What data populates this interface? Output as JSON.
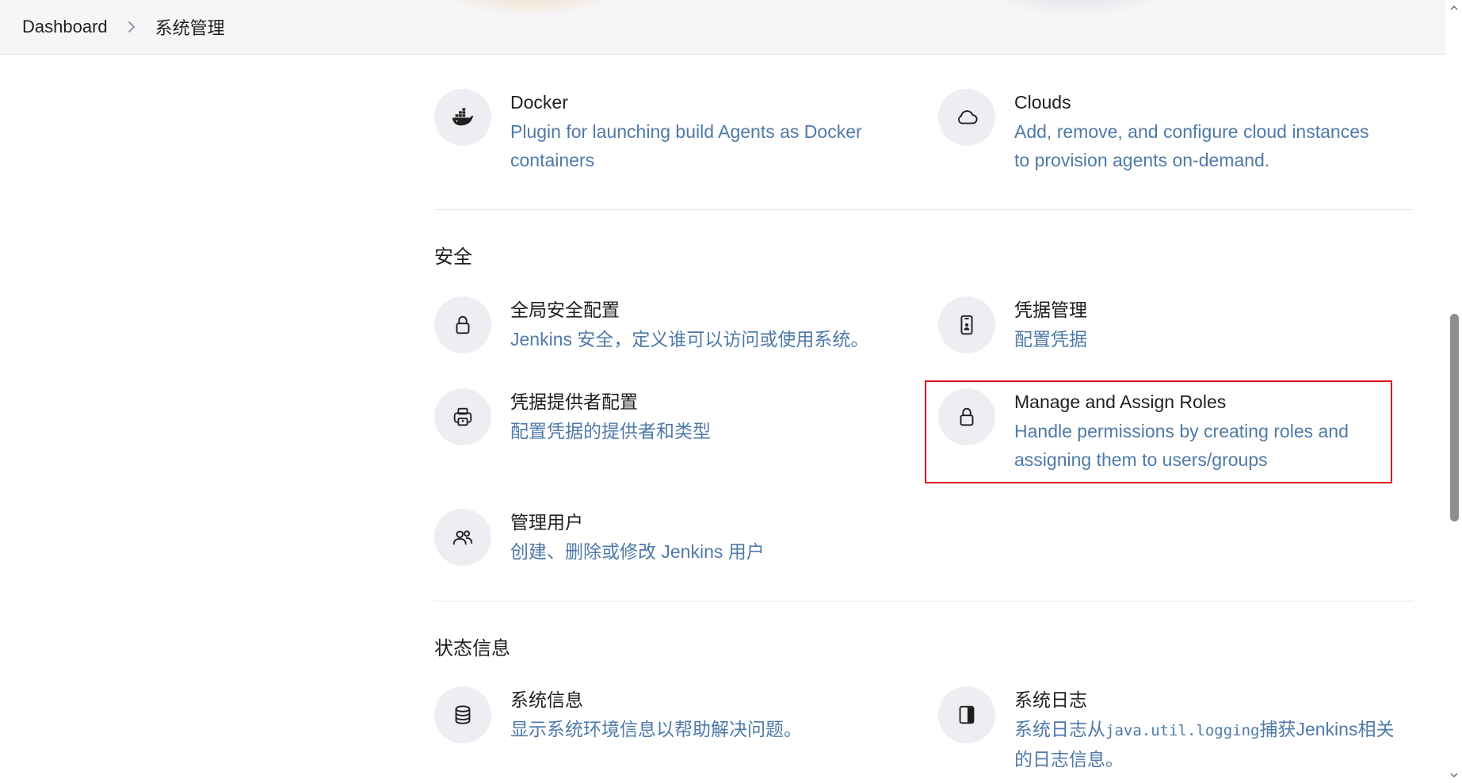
{
  "breadcrumb": {
    "home": "Dashboard",
    "current": "系统管理"
  },
  "sections": {
    "cloud": {
      "docker": {
        "title": "Docker",
        "desc_line1": "Plugin for launching build Agents as Docker",
        "desc_line2": "containers",
        "icon": "docker-icon"
      },
      "clouds": {
        "title": "Clouds",
        "desc_line1": "Add, remove, and configure cloud instances",
        "desc_line2": "to provision agents on-demand.",
        "icon": "cloud-icon"
      }
    },
    "security": {
      "title": "安全",
      "global_security": {
        "title": "全局安全配置",
        "desc": "Jenkins 安全，定义谁可以访问或使用系统。",
        "icon": "lock-icon"
      },
      "credentials": {
        "title": "凭据管理",
        "desc": "配置凭据",
        "icon": "id-card-icon"
      },
      "credential_providers": {
        "title": "凭据提供者配置",
        "desc": "配置凭据的提供者和类型",
        "icon": "credential-provider-icon"
      },
      "manage_roles": {
        "title": "Manage and Assign Roles",
        "desc_line1": "Handle permissions by creating roles and",
        "desc_line2": "assigning them to users/groups",
        "icon": "lock-icon"
      },
      "manage_users": {
        "title": "管理用户",
        "desc": "创建、删除或修改 Jenkins 用户",
        "icon": "users-icon"
      }
    },
    "status": {
      "title": "状态信息",
      "system_info": {
        "title": "系统信息",
        "desc": "显示系统环境信息以帮助解决问题。",
        "icon": "database-icon"
      },
      "system_log": {
        "title": "系统日志",
        "desc_pre": "系统日志从",
        "desc_code": "java.util.logging",
        "desc_post": "捕获Jenkins相关",
        "desc_line2": "的日志信息。",
        "icon": "log-panel-icon"
      }
    }
  },
  "colors": {
    "description": "#4f7aa8",
    "highlight_border": "#e0141e",
    "icon_background": "#ededf2"
  }
}
